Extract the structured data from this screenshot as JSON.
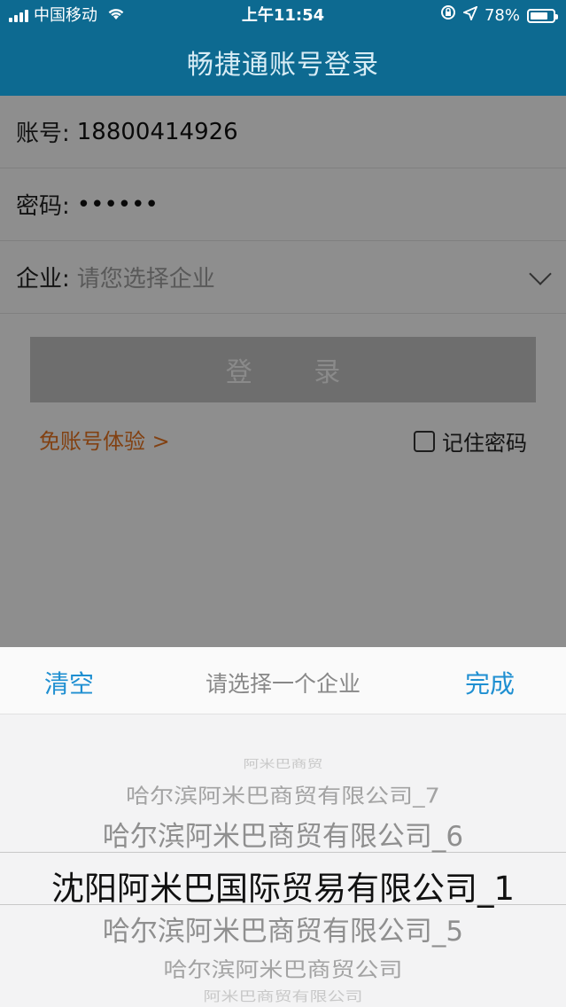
{
  "status_bar": {
    "carrier": "中国移动",
    "time": "上午11:54",
    "battery": "78%",
    "battery_level": 0.78,
    "icons": [
      "signal-icon",
      "wifi-icon",
      "orientation-lock-icon",
      "location-icon",
      "battery-icon"
    ]
  },
  "nav": {
    "title": "畅捷通账号登录"
  },
  "form": {
    "account_label": "账号:",
    "account_value": "18800414926",
    "password_label": "密码:",
    "password_value": "••••••",
    "company_label": "企业:",
    "company_placeholder": "请您选择企业",
    "login_button": "登 录",
    "trial_link": "免账号体验 >",
    "remember_label": "记住密码",
    "remember_checked": false
  },
  "picker": {
    "clear_label": "清空",
    "title": "请选择一个企业",
    "done_label": "完成",
    "options": [
      "阿米巴商贸",
      "哈尔滨阿米巴商贸有限公司_7",
      "哈尔滨阿米巴商贸有限公司_6",
      "沈阳阿米巴国际贸易有限公司_1",
      "哈尔滨阿米巴商贸有限公司_5",
      "哈尔滨阿米巴商贸公司",
      "阿米巴商贸有限公司"
    ],
    "selected_index": 3
  },
  "colors": {
    "brand": "#0d6a91",
    "accent_blue": "#1f8fd1",
    "link_orange": "#e07020"
  }
}
